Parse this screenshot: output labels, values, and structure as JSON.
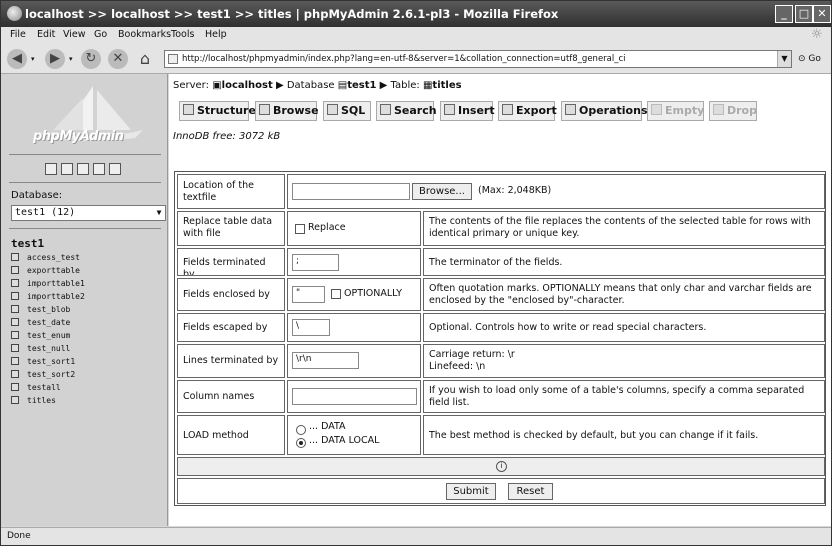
{
  "window": {
    "title": "localhost >> localhost >> test1 >> titles | phpMyAdmin 2.6.1-pl3 - Mozilla Firefox"
  },
  "menu": {
    "items": [
      "File",
      "Edit",
      "View",
      "Go",
      "Bookmarks",
      "Tools",
      "Help"
    ]
  },
  "toolbar": {
    "url": "http://localhost/phpmyadmin/index.php?lang=en-utf-8&server=1&collation_connection=utf8_general_ci",
    "go_label": "Go"
  },
  "sidebar": {
    "logo_text": "phpMyAdmin",
    "database_label": "Database:",
    "database_selected": "test1 (12)",
    "db_name": "test1",
    "tables": [
      "access_test",
      "exporttable",
      "importtable1",
      "importtable2",
      "test_blob",
      "test_date",
      "test_enum",
      "test_null",
      "test_sort1",
      "test_sort2",
      "testall",
      "titles"
    ]
  },
  "breadcrumb": {
    "server_label": "Server:",
    "server": "localhost",
    "database_label": "Database",
    "database": "test1",
    "table_label": "Table:",
    "table": "titles"
  },
  "tabs": [
    {
      "label": "Structure",
      "icon": "structure-icon",
      "disabled": false
    },
    {
      "label": "Browse",
      "icon": "browse-icon",
      "disabled": false
    },
    {
      "label": "SQL",
      "icon": "sql-icon",
      "disabled": false
    },
    {
      "label": "Search",
      "icon": "search-icon",
      "disabled": false
    },
    {
      "label": "Insert",
      "icon": "insert-icon",
      "disabled": false
    },
    {
      "label": "Export",
      "icon": "export-icon",
      "disabled": false
    },
    {
      "label": "Operations",
      "icon": "operations-icon",
      "disabled": false
    },
    {
      "label": "Empty",
      "icon": "empty-icon",
      "disabled": true
    },
    {
      "label": "Drop",
      "icon": "drop-icon",
      "disabled": true
    }
  ],
  "innodb_free": "InnoDB free: 3072 kB",
  "form": {
    "location_label": "Location of the textfile",
    "browse_button": "Browse...",
    "max_size": "(Max: 2,048KB)",
    "replace_label": "Replace table data with file",
    "replace_checkbox": "Replace",
    "replace_desc": "The contents of the file replaces the contents of the selected table for rows with identical primary or unique key.",
    "terminated_label": "Fields terminated by",
    "terminated_value": ";",
    "terminated_desc": "The terminator of the fields.",
    "enclosed_label": "Fields enclosed by",
    "enclosed_value": "\"",
    "optionally_label": "OPTIONALLY",
    "enclosed_desc": "Often quotation marks. OPTIONALLY means that only char and varchar fields are enclosed by the \"enclosed by\"-character.",
    "escaped_label": "Fields escaped by",
    "escaped_value": "\\",
    "escaped_desc": "Optional. Controls how to write or read special characters.",
    "lines_label": "Lines terminated by",
    "lines_value": "\\r\\n",
    "lines_desc_1": "Carriage return: \\r",
    "lines_desc_2": "Linefeed: \\n",
    "columns_label": "Column names",
    "columns_value": "",
    "columns_desc": "If you wish to load only some of a table's columns, specify a comma separated field list.",
    "load_label": "LOAD method",
    "load_option_1": "... DATA",
    "load_option_2": "... DATA LOCAL",
    "load_desc": "The best method is checked by default, but you can change if it fails.",
    "submit_button": "Submit",
    "reset_button": "Reset"
  },
  "status": {
    "text": "Done"
  }
}
